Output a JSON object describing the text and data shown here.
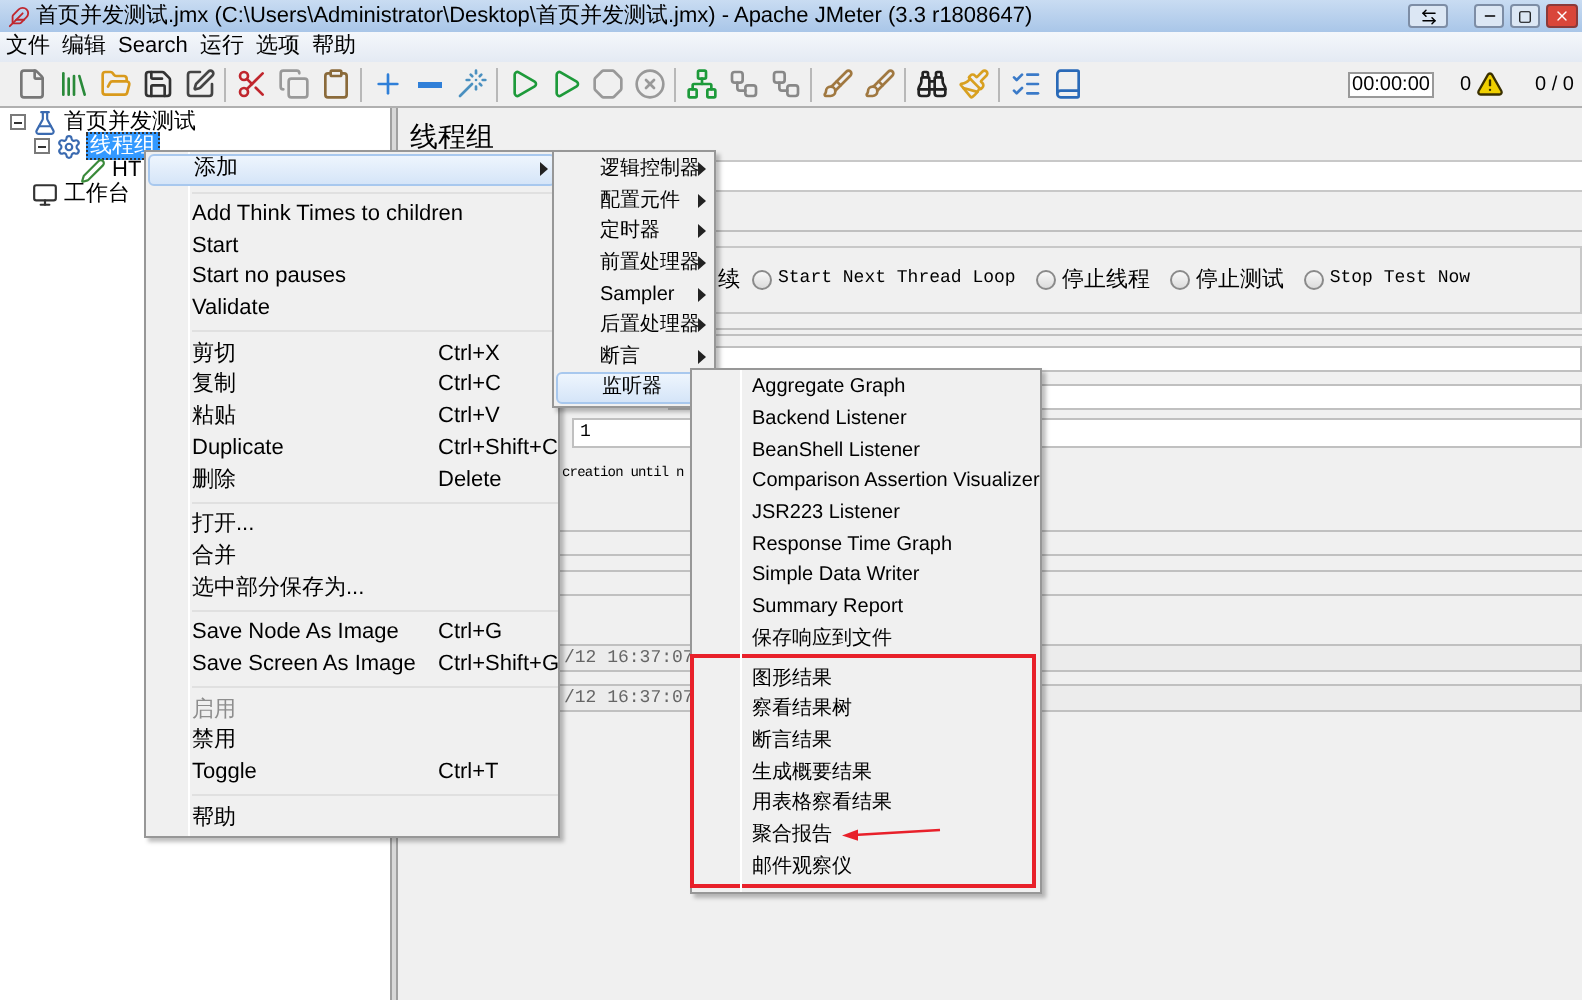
{
  "window": {
    "title": "首页并发测试.jmx (C:\\Users\\Administrator\\Desktop\\首页并发测试.jmx) - Apache JMeter (3.3 r1808647)"
  },
  "menu_bar": [
    "文件",
    "编辑",
    "Search",
    "运行",
    "选项",
    "帮助"
  ],
  "toolbar": {
    "timer": "00:00:00",
    "error_count": "0",
    "thread_count": "0 / 0"
  },
  "tree": [
    {
      "label": "首页并发测试",
      "kind": "test_plan",
      "expanded": true,
      "selected": false,
      "children": [
        {
          "label": "线程组",
          "kind": "thread_group",
          "expanded": true,
          "selected": true,
          "children": [
            {
              "label": "HT",
              "kind": "sampler",
              "selected": false
            }
          ]
        }
      ]
    },
    {
      "label": "工作台",
      "kind": "workbench",
      "selected": false
    }
  ],
  "panel": {
    "title": "线程组",
    "radio_label_tail": "续",
    "radios": [
      {
        "label": "Start Next Thread Loop",
        "selected": false
      },
      {
        "label": "停止线程",
        "selected": false
      },
      {
        "label": "停止测试",
        "selected": false
      },
      {
        "label": "Stop Test Now",
        "selected": false
      }
    ],
    "threads_value": "1",
    "note": "creation until n",
    "timestamps": [
      "/12 16:37:07",
      "/12 16:37:07"
    ]
  },
  "context_menu": {
    "groups": [
      [
        {
          "label": "添加",
          "submenu": true,
          "selected": true,
          "disabled": false
        }
      ],
      [
        {
          "label": "Add Think Times to children",
          "selected": false,
          "disabled": false
        },
        {
          "label": "Start",
          "selected": false,
          "disabled": false
        },
        {
          "label": "Start no pauses",
          "selected": false,
          "disabled": false
        },
        {
          "label": "Validate",
          "selected": false,
          "disabled": false
        }
      ],
      [
        {
          "label": "剪切",
          "shortcut": "Ctrl+X",
          "selected": false,
          "disabled": false
        },
        {
          "label": "复制",
          "shortcut": "Ctrl+C",
          "selected": false,
          "disabled": false
        },
        {
          "label": "粘贴",
          "shortcut": "Ctrl+V",
          "selected": false,
          "disabled": false
        },
        {
          "label": "Duplicate",
          "shortcut": "Ctrl+Shift+C",
          "selected": false,
          "disabled": false
        },
        {
          "label": "删除",
          "shortcut": "Delete",
          "selected": false,
          "disabled": false
        }
      ],
      [
        {
          "label": "打开...",
          "selected": false,
          "disabled": false
        },
        {
          "label": "合并",
          "selected": false,
          "disabled": false
        },
        {
          "label": "选中部分保存为...",
          "selected": false,
          "disabled": false
        }
      ],
      [
        {
          "label": "Save Node As Image",
          "shortcut": "Ctrl+G",
          "selected": false,
          "disabled": false
        },
        {
          "label": "Save Screen As Image",
          "shortcut": "Ctrl+Shift+G",
          "selected": false,
          "disabled": false
        }
      ],
      [
        {
          "label": "启用",
          "selected": false,
          "disabled": true
        },
        {
          "label": "禁用",
          "selected": false,
          "disabled": false
        },
        {
          "label": "Toggle",
          "shortcut": "Ctrl+T",
          "selected": false,
          "disabled": false
        }
      ],
      [
        {
          "label": "帮助",
          "selected": false,
          "disabled": false
        }
      ]
    ]
  },
  "add_submenu": {
    "items": [
      {
        "label": "逻辑控制器",
        "selected": false
      },
      {
        "label": "配置元件",
        "selected": false
      },
      {
        "label": "定时器",
        "selected": false
      },
      {
        "label": "前置处理器",
        "selected": false
      },
      {
        "label": "Sampler",
        "selected": false
      },
      {
        "label": "后置处理器",
        "selected": false
      },
      {
        "label": "断言",
        "selected": false
      },
      {
        "label": "监听器",
        "selected": true
      }
    ]
  },
  "listener_submenu": {
    "items": [
      {
        "label": "Aggregate Graph",
        "selected": false
      },
      {
        "label": "Backend Listener",
        "selected": false
      },
      {
        "label": "BeanShell Listener",
        "selected": false
      },
      {
        "label": "Comparison Assertion Visualizer",
        "selected": false
      },
      {
        "label": "JSR223 Listener",
        "selected": false
      },
      {
        "label": "Response Time Graph",
        "selected": false
      },
      {
        "label": "Simple Data Writer",
        "selected": false
      },
      {
        "label": "Summary Report",
        "selected": false
      },
      {
        "label": "保存响应到文件",
        "selected": false
      }
    ],
    "boxed_items": [
      {
        "label": "图形结果",
        "selected": false,
        "arrow": false
      },
      {
        "label": "察看结果树",
        "selected": false,
        "arrow": false
      },
      {
        "label": "断言结果",
        "selected": false,
        "arrow": false
      },
      {
        "label": "生成概要结果",
        "selected": false,
        "arrow": false
      },
      {
        "label": "用表格察看结果",
        "selected": false,
        "arrow": false
      },
      {
        "label": "聚合报告",
        "selected": false,
        "arrow": true
      },
      {
        "label": "邮件观察仪",
        "selected": false,
        "arrow": false
      }
    ]
  }
}
